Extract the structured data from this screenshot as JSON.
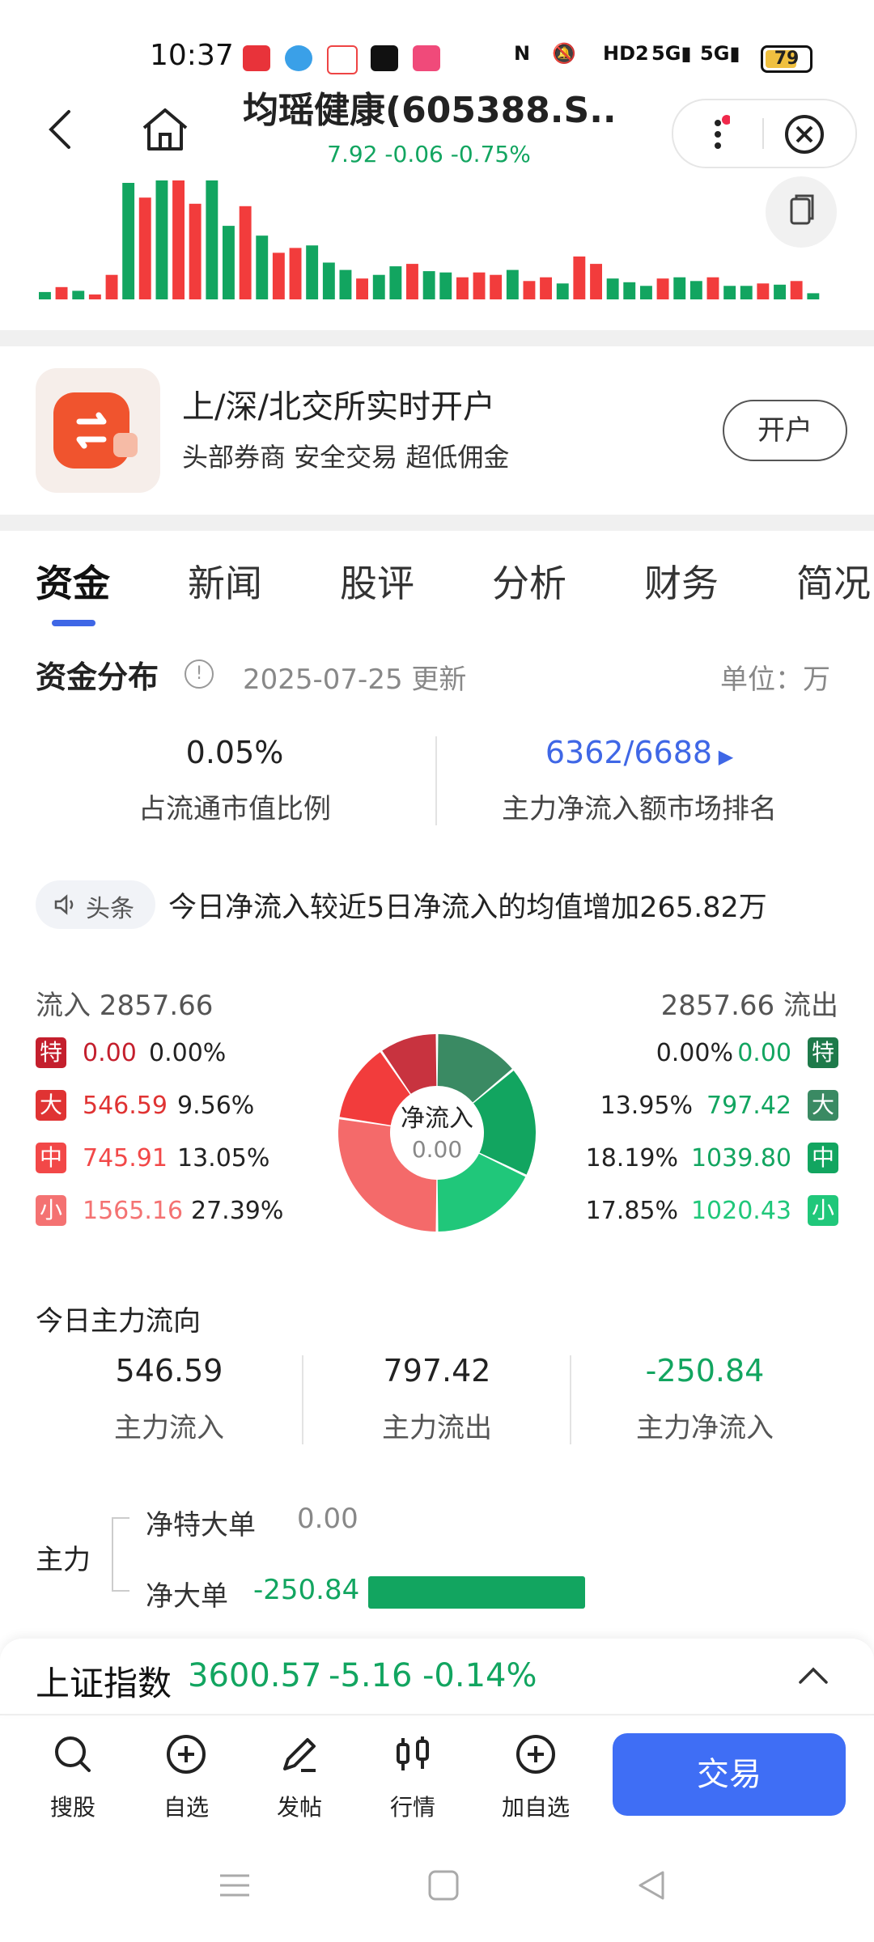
{
  "status_bar": {
    "time": "10:37",
    "battery": "79",
    "network_labels": [
      "HD2",
      "5G",
      "5G"
    ],
    "app_icons": [
      "toutiao-icon",
      "paper-plane-icon",
      "baidu-map-icon",
      "music-icon",
      "taobao-icon"
    ]
  },
  "header": {
    "title": "均瑶健康(605388.S...",
    "subtitle": "7.92 -0.06 -0.75%"
  },
  "volume_chart": {
    "colors": {
      "up": "#f23c3c",
      "down": "#12a560"
    },
    "bars": [
      {
        "v": 6,
        "c": "down"
      },
      {
        "v": 10,
        "c": "up"
      },
      {
        "v": 7,
        "c": "down"
      },
      {
        "v": 4,
        "c": "up"
      },
      {
        "v": 20,
        "c": "up"
      },
      {
        "v": 95,
        "c": "down"
      },
      {
        "v": 83,
        "c": "up"
      },
      {
        "v": 97,
        "c": "down"
      },
      {
        "v": 97,
        "c": "up"
      },
      {
        "v": 78,
        "c": "up"
      },
      {
        "v": 97,
        "c": "down"
      },
      {
        "v": 60,
        "c": "down"
      },
      {
        "v": 76,
        "c": "up"
      },
      {
        "v": 52,
        "c": "down"
      },
      {
        "v": 38,
        "c": "up"
      },
      {
        "v": 42,
        "c": "up"
      },
      {
        "v": 44,
        "c": "down"
      },
      {
        "v": 30,
        "c": "down"
      },
      {
        "v": 24,
        "c": "down"
      },
      {
        "v": 17,
        "c": "up"
      },
      {
        "v": 20,
        "c": "down"
      },
      {
        "v": 27,
        "c": "down"
      },
      {
        "v": 29,
        "c": "up"
      },
      {
        "v": 23,
        "c": "down"
      },
      {
        "v": 22,
        "c": "down"
      },
      {
        "v": 18,
        "c": "up"
      },
      {
        "v": 22,
        "c": "up"
      },
      {
        "v": 20,
        "c": "up"
      },
      {
        "v": 24,
        "c": "down"
      },
      {
        "v": 15,
        "c": "up"
      },
      {
        "v": 18,
        "c": "up"
      },
      {
        "v": 13,
        "c": "down"
      },
      {
        "v": 35,
        "c": "up"
      },
      {
        "v": 29,
        "c": "up"
      },
      {
        "v": 17,
        "c": "down"
      },
      {
        "v": 14,
        "c": "down"
      },
      {
        "v": 11,
        "c": "down"
      },
      {
        "v": 17,
        "c": "up"
      },
      {
        "v": 18,
        "c": "down"
      },
      {
        "v": 15,
        "c": "down"
      },
      {
        "v": 18,
        "c": "up"
      },
      {
        "v": 11,
        "c": "down"
      },
      {
        "v": 11,
        "c": "down"
      },
      {
        "v": 13,
        "c": "up"
      },
      {
        "v": 12,
        "c": "down"
      },
      {
        "v": 15,
        "c": "up"
      },
      {
        "v": 5,
        "c": "down"
      }
    ]
  },
  "ad": {
    "title": "上/深/北交所实时开户",
    "subtitle": "头部券商  安全交易  超低佣金",
    "button": "开户"
  },
  "tabs": [
    "资金",
    "新闻",
    "股评",
    "分析",
    "财务",
    "简况"
  ],
  "fund": {
    "title": "资金分布",
    "updated": "2025-07-25 更新",
    "unit": "单位：万",
    "ratio_value": "0.05%",
    "ratio_label": "占流通市值比例",
    "rank_value": "6362/6688",
    "rank_label": "主力净流入额市场排名"
  },
  "news": {
    "badge": "头条",
    "text": "今日净流入较近5日净流入的均值增加265.82万"
  },
  "flow": {
    "inflow_label": "流入 2857.66",
    "outflow_label": "2857.66 流出",
    "center_title": "净流入",
    "center_value": "0.00",
    "inflow_rows": [
      {
        "tag": "特",
        "value": "0.00",
        "pct": "0.00%",
        "color": "#c41f2d"
      },
      {
        "tag": "大",
        "value": "546.59",
        "pct": "9.56%",
        "color": "#e03333"
      },
      {
        "tag": "中",
        "value": "745.91",
        "pct": "13.05%",
        "color": "#f24848"
      },
      {
        "tag": "小",
        "value": "1565.16",
        "pct": "27.39%",
        "color": "#f47272"
      }
    ],
    "outflow_rows": [
      {
        "tag": "特",
        "value": "0.00",
        "pct": "0.00%",
        "color": "#1e7a4a"
      },
      {
        "tag": "大",
        "value": "797.42",
        "pct": "13.95%",
        "color": "#3a8a63"
      },
      {
        "tag": "中",
        "value": "1039.80",
        "pct": "18.19%",
        "color": "#12a560"
      },
      {
        "tag": "小",
        "value": "1020.43",
        "pct": "17.85%",
        "color": "#20c77a"
      }
    ]
  },
  "today": {
    "title": "今日主力流向",
    "inflow_value": "546.59",
    "inflow_label": "主力流入",
    "outflow_value": "797.42",
    "outflow_label": "主力流出",
    "net_value": "-250.84",
    "net_label": "主力净流入"
  },
  "main_force": {
    "label": "主力",
    "row1_label": "净特大单",
    "row1_value": "0.00",
    "row2_label": "净大单",
    "row2_value": "-250.84"
  },
  "index_bar": {
    "name": "上证指数",
    "value": "3600.57",
    "change": "-5.16",
    "pct": "-0.14%"
  },
  "bottom_nav": [
    "搜股",
    "自选",
    "发帖",
    "行情",
    "加自选"
  ],
  "trade_button": "交易",
  "chart_data": {
    "type": "pie",
    "title": "净流入",
    "center_value": "0.00",
    "slices": [
      {
        "label": "特 流出",
        "value": 0.0
      },
      {
        "label": "大 流出",
        "value": 797.42
      },
      {
        "label": "中 流出",
        "value": 1039.8
      },
      {
        "label": "小 流出",
        "value": 1020.43
      },
      {
        "label": "小 流入",
        "value": 1565.16
      },
      {
        "label": "中 流入",
        "value": 745.91
      },
      {
        "label": "大 流入",
        "value": 546.59
      },
      {
        "label": "特 流入",
        "value": 0.0
      }
    ],
    "slice_colors": [
      "#1e7a4a",
      "#3a8a63",
      "#12a560",
      "#20c77a",
      "#f46a6a",
      "#f23c3c",
      "#c8333f",
      "#c41f2d"
    ]
  }
}
